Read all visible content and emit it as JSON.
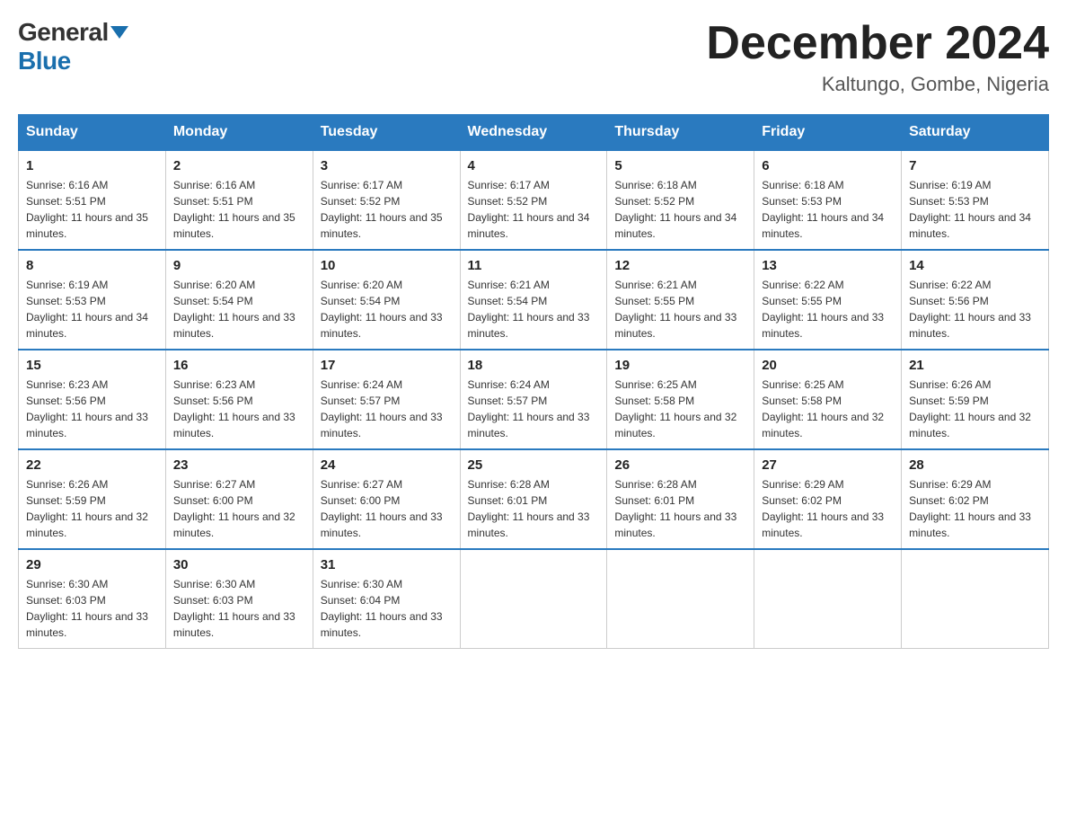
{
  "header": {
    "logo_general": "General",
    "logo_blue": "Blue",
    "month_title": "December 2024",
    "location": "Kaltungo, Gombe, Nigeria"
  },
  "days_of_week": [
    "Sunday",
    "Monday",
    "Tuesday",
    "Wednesday",
    "Thursday",
    "Friday",
    "Saturday"
  ],
  "weeks": [
    [
      {
        "day": "1",
        "sunrise": "6:16 AM",
        "sunset": "5:51 PM",
        "daylight": "11 hours and 35 minutes."
      },
      {
        "day": "2",
        "sunrise": "6:16 AM",
        "sunset": "5:51 PM",
        "daylight": "11 hours and 35 minutes."
      },
      {
        "day": "3",
        "sunrise": "6:17 AM",
        "sunset": "5:52 PM",
        "daylight": "11 hours and 35 minutes."
      },
      {
        "day": "4",
        "sunrise": "6:17 AM",
        "sunset": "5:52 PM",
        "daylight": "11 hours and 34 minutes."
      },
      {
        "day": "5",
        "sunrise": "6:18 AM",
        "sunset": "5:52 PM",
        "daylight": "11 hours and 34 minutes."
      },
      {
        "day": "6",
        "sunrise": "6:18 AM",
        "sunset": "5:53 PM",
        "daylight": "11 hours and 34 minutes."
      },
      {
        "day": "7",
        "sunrise": "6:19 AM",
        "sunset": "5:53 PM",
        "daylight": "11 hours and 34 minutes."
      }
    ],
    [
      {
        "day": "8",
        "sunrise": "6:19 AM",
        "sunset": "5:53 PM",
        "daylight": "11 hours and 34 minutes."
      },
      {
        "day": "9",
        "sunrise": "6:20 AM",
        "sunset": "5:54 PM",
        "daylight": "11 hours and 33 minutes."
      },
      {
        "day": "10",
        "sunrise": "6:20 AM",
        "sunset": "5:54 PM",
        "daylight": "11 hours and 33 minutes."
      },
      {
        "day": "11",
        "sunrise": "6:21 AM",
        "sunset": "5:54 PM",
        "daylight": "11 hours and 33 minutes."
      },
      {
        "day": "12",
        "sunrise": "6:21 AM",
        "sunset": "5:55 PM",
        "daylight": "11 hours and 33 minutes."
      },
      {
        "day": "13",
        "sunrise": "6:22 AM",
        "sunset": "5:55 PM",
        "daylight": "11 hours and 33 minutes."
      },
      {
        "day": "14",
        "sunrise": "6:22 AM",
        "sunset": "5:56 PM",
        "daylight": "11 hours and 33 minutes."
      }
    ],
    [
      {
        "day": "15",
        "sunrise": "6:23 AM",
        "sunset": "5:56 PM",
        "daylight": "11 hours and 33 minutes."
      },
      {
        "day": "16",
        "sunrise": "6:23 AM",
        "sunset": "5:56 PM",
        "daylight": "11 hours and 33 minutes."
      },
      {
        "day": "17",
        "sunrise": "6:24 AM",
        "sunset": "5:57 PM",
        "daylight": "11 hours and 33 minutes."
      },
      {
        "day": "18",
        "sunrise": "6:24 AM",
        "sunset": "5:57 PM",
        "daylight": "11 hours and 33 minutes."
      },
      {
        "day": "19",
        "sunrise": "6:25 AM",
        "sunset": "5:58 PM",
        "daylight": "11 hours and 32 minutes."
      },
      {
        "day": "20",
        "sunrise": "6:25 AM",
        "sunset": "5:58 PM",
        "daylight": "11 hours and 32 minutes."
      },
      {
        "day": "21",
        "sunrise": "6:26 AM",
        "sunset": "5:59 PM",
        "daylight": "11 hours and 32 minutes."
      }
    ],
    [
      {
        "day": "22",
        "sunrise": "6:26 AM",
        "sunset": "5:59 PM",
        "daylight": "11 hours and 32 minutes."
      },
      {
        "day": "23",
        "sunrise": "6:27 AM",
        "sunset": "6:00 PM",
        "daylight": "11 hours and 32 minutes."
      },
      {
        "day": "24",
        "sunrise": "6:27 AM",
        "sunset": "6:00 PM",
        "daylight": "11 hours and 33 minutes."
      },
      {
        "day": "25",
        "sunrise": "6:28 AM",
        "sunset": "6:01 PM",
        "daylight": "11 hours and 33 minutes."
      },
      {
        "day": "26",
        "sunrise": "6:28 AM",
        "sunset": "6:01 PM",
        "daylight": "11 hours and 33 minutes."
      },
      {
        "day": "27",
        "sunrise": "6:29 AM",
        "sunset": "6:02 PM",
        "daylight": "11 hours and 33 minutes."
      },
      {
        "day": "28",
        "sunrise": "6:29 AM",
        "sunset": "6:02 PM",
        "daylight": "11 hours and 33 minutes."
      }
    ],
    [
      {
        "day": "29",
        "sunrise": "6:30 AM",
        "sunset": "6:03 PM",
        "daylight": "11 hours and 33 minutes."
      },
      {
        "day": "30",
        "sunrise": "6:30 AM",
        "sunset": "6:03 PM",
        "daylight": "11 hours and 33 minutes."
      },
      {
        "day": "31",
        "sunrise": "6:30 AM",
        "sunset": "6:04 PM",
        "daylight": "11 hours and 33 minutes."
      },
      null,
      null,
      null,
      null
    ]
  ]
}
